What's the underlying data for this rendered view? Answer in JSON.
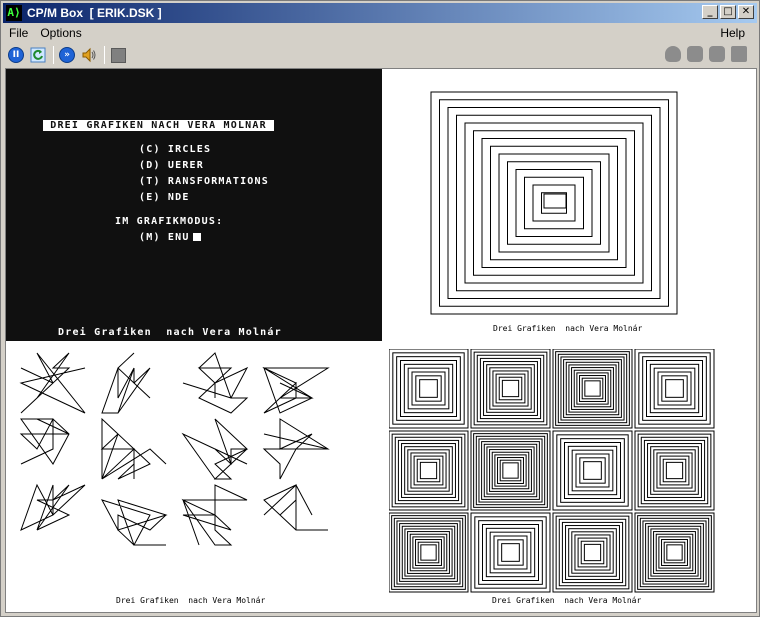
{
  "window": {
    "app_icon": "A⟩",
    "title": "CP/M Box  [ ERIK.DSK ]",
    "buttons": {
      "minimize": "_",
      "maximize": "□",
      "close": "✕"
    }
  },
  "menu": {
    "file": "File",
    "options": "Options",
    "help": "Help"
  },
  "toolbar": {
    "icons": [
      "pause-icon",
      "refresh-icon",
      "fast-forward-icon",
      "speaker-icon",
      "stop-icon"
    ],
    "right_icons": [
      "disk-icon",
      "hand-icon",
      "hand-pointer-icon",
      "drive-icon"
    ]
  },
  "terminal": {
    "title": " DREI GRAFIKEN NACH VERA MOLNAR ",
    "items": [
      "(C) IRCLES",
      "(D) UERER",
      "(T) RANSFORMATIONS",
      "(E) NDE"
    ],
    "mode_label": "IM GRAFIKMODUS:",
    "menu_item": "(M) ENU",
    "footer": "Drei Grafiken  nach Vera Molnár"
  },
  "captions": {
    "top_right": "Drei Grafiken  nach Vera Molnár",
    "bottom_left": "Drei Grafiken  nach Vera Molnár",
    "bottom_right": "Drei Grafiken  nach Vera Molnár"
  }
}
